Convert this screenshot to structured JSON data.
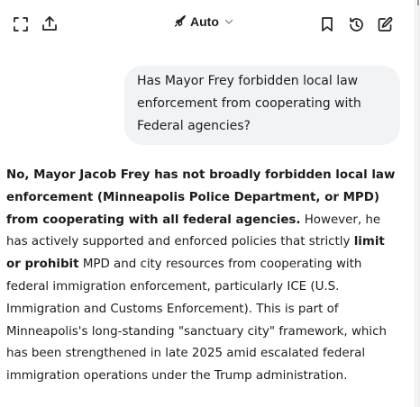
{
  "toolbar": {
    "model_label": "Auto",
    "icons": {
      "expand": "expand-icon",
      "share": "share-upload-icon",
      "rocket": "rocket-icon",
      "chevron": "chevron-down-icon",
      "bookmark": "bookmark-icon",
      "history": "history-icon",
      "new_chat": "edit-compose-icon"
    }
  },
  "conversation": {
    "user_message": {
      "line1": "Has Mayor Frey forbidden local law",
      "line2": "enforcement from cooperating with",
      "line3": "Federal agencies?"
    },
    "assistant_message": {
      "bold_intro": "No, Mayor Jacob Frey has not broadly forbidden local law enforcement (Minneapolis Police Department, or MPD) from cooperating with all federal agencies.",
      "text_1": " However, he has actively supported and enforced policies that strictly ",
      "bold_phrase": "limit or prohibit",
      "text_2": " MPD and city resources from cooperating with federal immigration enforcement, particularly ICE (U.S. Immigration and Customs Enforcement). This is part of Minneapolis's long-standing \"sanctuary city\" framework, which has been strengthened in late 2025 amid escalated federal immigration operations under the Trump administration."
    }
  },
  "colors": {
    "background": "#ffffff",
    "bubble": "#f1f3f5",
    "text": "#1c1c1c",
    "icon": "#222222",
    "chevron": "#8a8a8a"
  }
}
